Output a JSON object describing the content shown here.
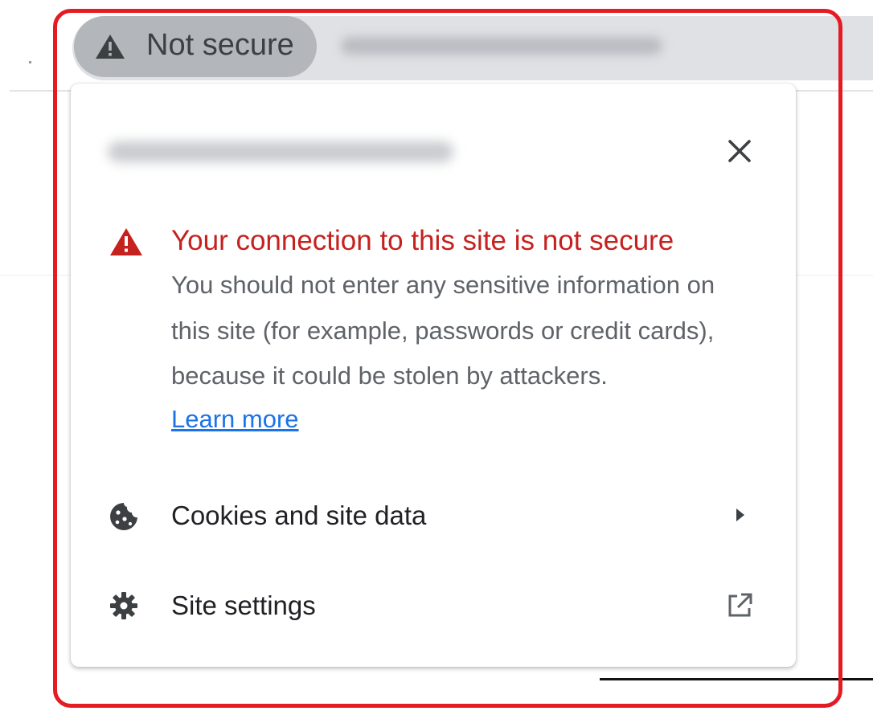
{
  "colors": {
    "accent_red": "#c5221f",
    "link_blue": "#1a73e8",
    "highlight_border": "#e51b24",
    "chip_bg": "#b3b6bb"
  },
  "omnibox": {
    "chip_icon": "warning-triangle-icon",
    "chip_label": "Not secure"
  },
  "popup": {
    "close_icon": "close-icon",
    "warning": {
      "icon": "warning-triangle-icon",
      "title": "Your connection to this site is not secure",
      "body": "You should not enter any sensitive information on this site (for example, passwords or credit cards), because it could be stolen by attackers.",
      "link": "Learn more"
    },
    "items": [
      {
        "icon": "cookie-icon",
        "label": "Cookies and site data",
        "trailing_icon": "chevron-right-icon"
      },
      {
        "icon": "gear-icon",
        "label": "Site settings",
        "trailing_icon": "open-in-new-icon"
      }
    ]
  }
}
